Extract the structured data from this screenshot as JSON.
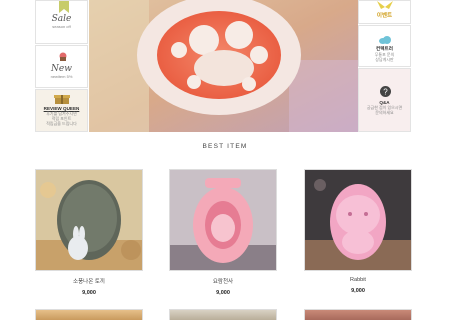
{
  "left_sidebar": {
    "sale": {
      "title": "Sale",
      "sub": "season off"
    },
    "new": {
      "title": "New",
      "sub": "newitem 5%"
    },
    "review": {
      "title": "REVIEW QUEEN",
      "lines": [
        "후기를 남겨주시면",
        "적립 포인트",
        "적립금을 드립니다"
      ]
    }
  },
  "right_sidebar": {
    "event": {
      "title": "이벤트"
    },
    "cs": {
      "title": "컨텍트러",
      "lines": [
        "무통포 문의",
        "상담게시판"
      ]
    },
    "qa": {
      "title": "Q&A",
      "lines": [
        "궁금한 점이 있으시면",
        "문의하세요"
      ]
    }
  },
  "section_title": "BEST ITEM",
  "products": [
    {
      "name": "소풍나온 토끼",
      "price": "9,000"
    },
    {
      "name": "요람천사",
      "price": "9,000"
    },
    {
      "name": "Rabbit",
      "price": "9,000"
    }
  ],
  "colors": {
    "accent": "#e5a6b4",
    "bg": "#ffffff",
    "border": "#dddddd"
  },
  "icons": [
    "bookmark-icon",
    "cupcake-icon",
    "gift-box-icon",
    "ribbon-icon",
    "cloud-icon",
    "question-icon"
  ]
}
